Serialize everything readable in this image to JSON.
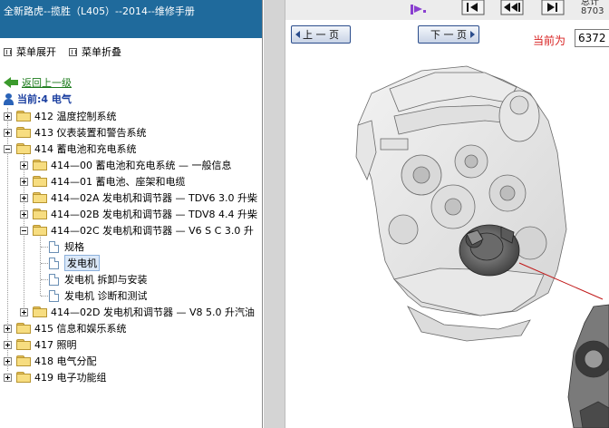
{
  "app": {
    "title": "全新路虎--揽胜（L405）--2014--维修手册"
  },
  "menu": {
    "expand_label": "菜单展开",
    "collapse_label": "菜单折叠"
  },
  "nav": {
    "back_label": "返回上一级",
    "current_label": "当前:4 电气"
  },
  "tree": {
    "items": [
      {
        "label": "412 温度控制系统"
      },
      {
        "label": "413 仪表装置和警告系统"
      },
      {
        "label": "414 蓄电池和充电系统"
      },
      {
        "label": "414—00 蓄电池和充电系统 — 一般信息"
      },
      {
        "label": "414—01 蓄电池、座架和电缆"
      },
      {
        "label": "414—02A 发电机和调节器 — TDV6 3.0 升柴"
      },
      {
        "label": "414—02B 发电机和调节器 — TDV8 4.4 升柴"
      },
      {
        "label": "414—02C 发电机和调节器 — V6 S C 3.0 升"
      },
      {
        "label": "规格"
      },
      {
        "label": "发电机"
      },
      {
        "label": "发电机 拆卸与安装"
      },
      {
        "label": "发电机 诊断和测试"
      },
      {
        "label": "414—02D 发电机和调节器 — V8 5.0 升汽油"
      },
      {
        "label": "415 信息和娱乐系统"
      },
      {
        "label": "417 照明"
      },
      {
        "label": "418 电气分配"
      },
      {
        "label": "419 电子功能组"
      }
    ]
  },
  "viewer": {
    "prev_label": "上 一 页",
    "next_label": "下 一 页",
    "current_prefix": "当前为",
    "page_value": "6372",
    "toolbar_text_top": "总计",
    "toolbar_text_bottom": "8703"
  },
  "colors": {
    "title_bar": "#1f6a9c",
    "current_label": "#1b3fa0",
    "back_link": "#1a7a1a",
    "current_prefix": "#d82020"
  }
}
